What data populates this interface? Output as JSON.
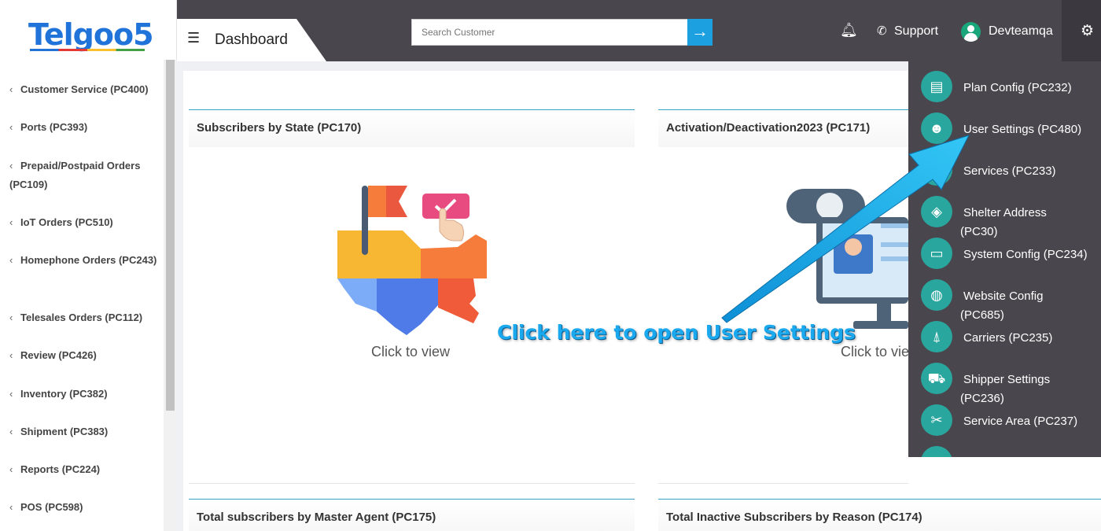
{
  "logo": {
    "text": "Telgoo5"
  },
  "header": {
    "page_title": "Dashboard",
    "search_placeholder": "Search Customer",
    "support_label": "Support",
    "username": "Devteamqa"
  },
  "sidebar": {
    "items": [
      {
        "label": "Customer Service (PC400)"
      },
      {
        "label": "Ports (PC393)"
      },
      {
        "label": "Prepaid/Postpaid Orders (PC109)"
      },
      {
        "label": "IoT Orders (PC510)"
      },
      {
        "label": "Homephone Orders (PC243)"
      },
      {
        "label": "Telesales Orders (PC112)"
      },
      {
        "label": "Review (PC426)"
      },
      {
        "label": "Inventory (PC382)"
      },
      {
        "label": "Shipment (PC383)"
      },
      {
        "label": "Reports (PC224)"
      },
      {
        "label": "POS (PC598)"
      }
    ]
  },
  "cards": [
    {
      "title": "Subscribers by State (PC170)",
      "cta": "Click to view"
    },
    {
      "title": "Activation/Deactivation2023 (PC171)",
      "cta": "Click to view"
    },
    {
      "title": "Total subscribers by Master Agent (PC175)"
    },
    {
      "title": "Total Inactive Subscribers by Reason (PC174)"
    }
  ],
  "settings_menu": {
    "items": [
      {
        "label": "Plan Config (PC232)",
        "icon": "clipboard-icon"
      },
      {
        "label": "User Settings (PC480)",
        "icon": "user-gear-icon"
      },
      {
        "label": "Services (PC233)",
        "icon": "services-icon"
      },
      {
        "label": "Shelter Address",
        "label2": "(PC30)",
        "icon": "map-icon"
      },
      {
        "label": "System Config (PC234)",
        "icon": "monitor-icon"
      },
      {
        "label": "Website Config",
        "label2": "(PC685)",
        "icon": "globe-icon"
      },
      {
        "label": "Carriers (PC235)",
        "icon": "tower-icon"
      },
      {
        "label": "Shipper Settings",
        "label2": "(PC236)",
        "icon": "truck-icon"
      },
      {
        "label": "Service Area (PC237)",
        "icon": "tools-icon"
      }
    ]
  },
  "annotation": {
    "text": "Click here to open User Settings"
  },
  "colors": {
    "topbar": "#4a464d",
    "accent": "#1ca0e0",
    "icon_bg": "#29a69e"
  }
}
